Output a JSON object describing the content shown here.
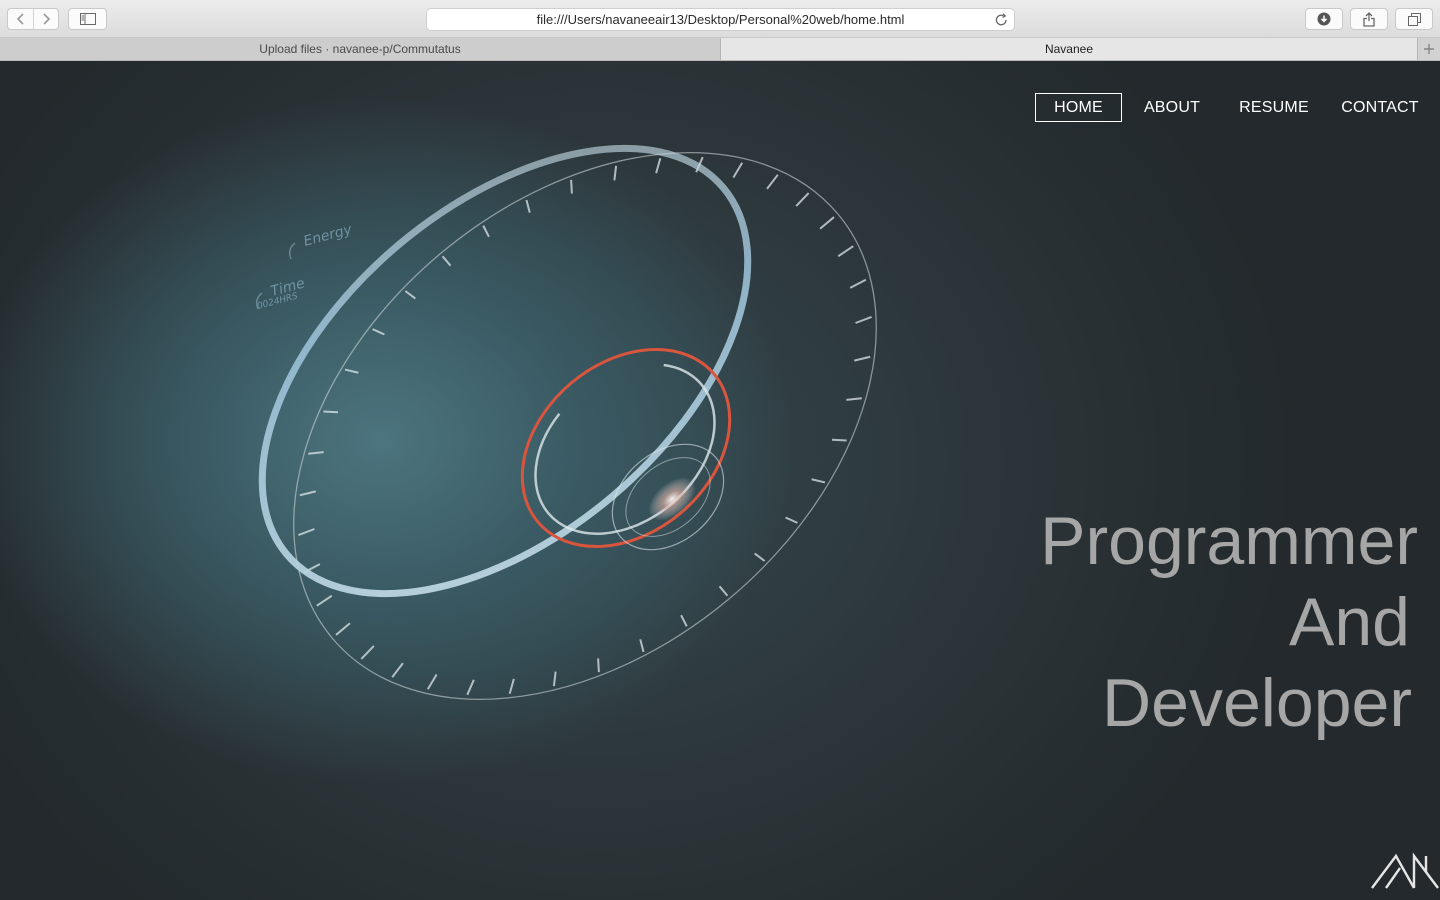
{
  "browser": {
    "url": "file:///Users/navaneeair13/Desktop/Personal%20web/home.html",
    "tabs": [
      {
        "label": "Upload files · navanee-p/Commutatus",
        "active": false
      },
      {
        "label": "Navanee",
        "active": true
      }
    ],
    "icons": [
      "back-icon",
      "forward-icon",
      "sidebar-icon",
      "reload-icon",
      "downloads-icon",
      "share-icon",
      "tabs-overview-icon",
      "new-tab-icon"
    ]
  },
  "nav": {
    "items": [
      {
        "label": "HOME",
        "active": true
      },
      {
        "label": "ABOUT",
        "active": false
      },
      {
        "label": "RESUME",
        "active": false
      },
      {
        "label": "CONTACT",
        "active": false
      }
    ]
  },
  "hero": {
    "lines": [
      "Programmer",
      "And",
      "Developer"
    ],
    "hud_labels": [
      "Energy",
      "Time",
      "0024HRS"
    ]
  },
  "colors": {
    "nav_text": "#ffffff",
    "tagline": "#a6a6a6",
    "accent_red": "#d9553e",
    "hud_blue": "#9fc6dc"
  }
}
